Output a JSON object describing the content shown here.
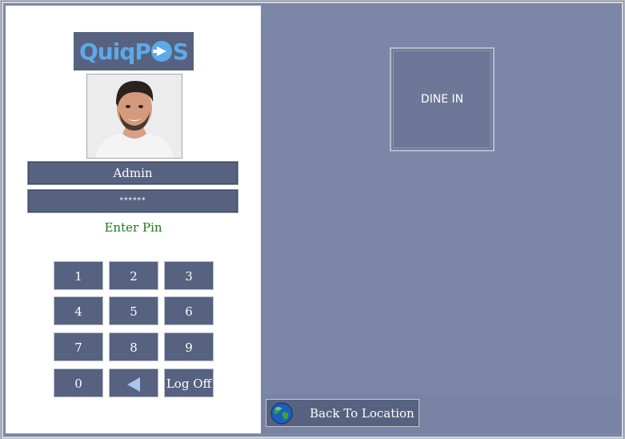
{
  "login": {
    "logo": {
      "part1": "Quiq",
      "part2": "P",
      "part3": "S"
    },
    "username": "Admin",
    "pin_mask": "******",
    "prompt": "Enter Pin",
    "keypad": [
      "1",
      "2",
      "3",
      "4",
      "5",
      "6",
      "7",
      "8",
      "9",
      "0"
    ],
    "logoff_label": "Log Off"
  },
  "main": {
    "dine_in_label": "DINE IN",
    "back_label": "Back To Location"
  },
  "colors": {
    "panel_bg": "#7c87a8",
    "button_bg": "#56627f",
    "prompt_text": "#1a7a1a",
    "logo_blue": "#5ea9e8"
  }
}
